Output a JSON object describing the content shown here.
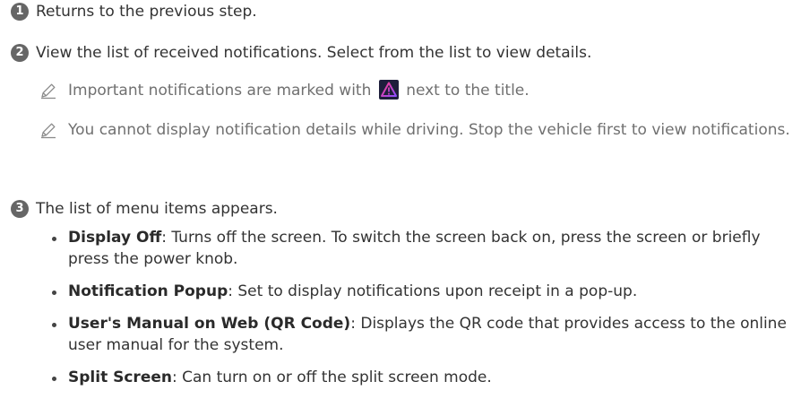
{
  "steps": [
    {
      "number": "1",
      "text": "Returns to the previous step."
    },
    {
      "number": "2",
      "text": "View the list of received notifications. Select from the list to view details."
    },
    {
      "number": "3",
      "text": "The list of menu items appears."
    }
  ],
  "notes": [
    {
      "before": "Important notifications are marked with",
      "after": "next to the title.",
      "icon": "warning-triangle-icon"
    },
    {
      "text": "You cannot display notification details while driving. Stop the vehicle first to view notifications.",
      "icon": "pencil-icon"
    }
  ],
  "menu_items": [
    {
      "term": "Display Off",
      "desc": ": Turns off the screen. To switch the screen back on, press the screen or briefly press the power knob."
    },
    {
      "term": "Notification Popup",
      "desc": ": Set to display notifications upon receipt in a pop-up."
    },
    {
      "term": "User's Manual on Web (QR Code)",
      "desc": ": Displays the QR code that provides access to the online user manual for the system."
    },
    {
      "term": "Split Screen",
      "desc": ": Can turn on or off the split screen mode."
    }
  ],
  "colors": {
    "text": "#333333",
    "note_text": "#707070",
    "badge_bg": "#666666",
    "warning_bg": "#1e1e3c",
    "warning_gradient_start": "#ff3b8a",
    "warning_gradient_end": "#8a4dff"
  }
}
